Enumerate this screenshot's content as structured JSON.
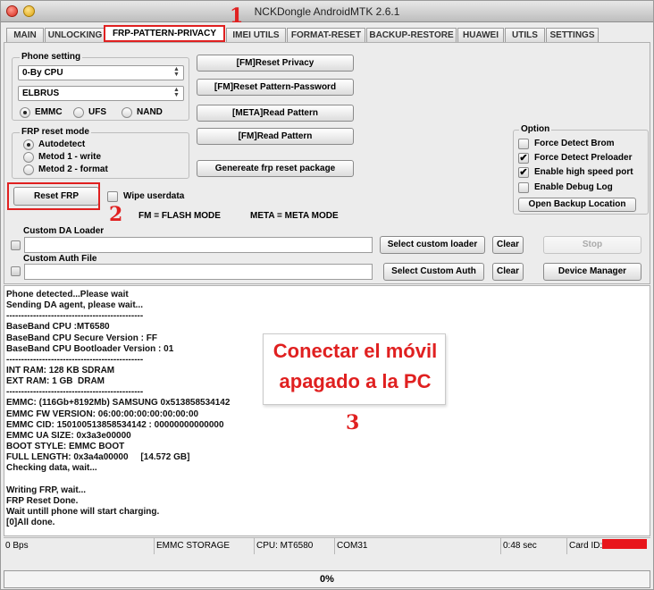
{
  "window": {
    "title": "NCKDongle AndroidMTK 2.6.1"
  },
  "tabs": [
    {
      "label": "MAIN"
    },
    {
      "label": "UNLOCKING"
    },
    {
      "label": "FRP-PATTERN-PRIVACY",
      "active": true
    },
    {
      "label": "IMEI UTILS"
    },
    {
      "label": "FORMAT-RESET"
    },
    {
      "label": "BACKUP-RESTORE"
    },
    {
      "label": "HUAWEI"
    },
    {
      "label": "UTILS"
    },
    {
      "label": "SETTINGS"
    }
  ],
  "phone_setting": {
    "title": "Phone setting",
    "cpu_select": "0-By CPU",
    "model_select": "ELBRUS",
    "storage_options": [
      {
        "label": "EMMC",
        "selected": true
      },
      {
        "label": "UFS",
        "selected": false
      },
      {
        "label": "NAND",
        "selected": false
      }
    ]
  },
  "frp_reset_mode": {
    "title": "FRP reset mode",
    "options": [
      {
        "label": "Autodetect",
        "selected": true
      },
      {
        "label": "Metod 1 - write",
        "selected": false
      },
      {
        "label": "Metod 2 - format",
        "selected": false
      }
    ]
  },
  "actions": {
    "reset_privacy": "[FM]Reset Privacy",
    "reset_pattern_password": "[FM]Reset Pattern-Password",
    "read_pattern_meta": "[META]Read Pattern",
    "read_pattern_fm": "[FM]Read Pattern",
    "generate_package": "Genereate frp reset package",
    "reset_frp": "Reset FRP"
  },
  "wipe_userdata": {
    "label": "Wipe userdata",
    "checked": false
  },
  "mode_legend": {
    "flash": "FM = FLASH MODE",
    "meta": "META = META MODE"
  },
  "options": {
    "title": "Option",
    "items": [
      {
        "label": "Force Detect Brom",
        "checked": false
      },
      {
        "label": "Force Detect Preloader",
        "checked": true
      },
      {
        "label": "Enable high speed port",
        "checked": true
      },
      {
        "label": "Enable Debug Log",
        "checked": false
      }
    ],
    "backup_location_button": "Open Backup Location"
  },
  "loaders": {
    "custom_da_label": "Custom DA Loader",
    "custom_auth_label": "Custom Auth File",
    "select_custom_loader": "Select custom loader",
    "select_custom_auth": "Select Custom Auth",
    "clear": "Clear",
    "stop": "Stop",
    "device_manager": "Device Manager"
  },
  "log_lines": [
    "Phone detected...Please wait",
    "Sending DA agent, please wait...",
    "----------------------------------------------",
    "BaseBand CPU :MT6580",
    "BaseBand CPU Secure Version : FF",
    "BaseBand CPU Bootloader Version : 01",
    "----------------------------------------------",
    "INT RAM: 128 KB SDRAM",
    "EXT RAM: 1 GB  DRAM",
    "----------------------------------------------",
    "EMMC: (116Gb+8192Mb) SAMSUNG 0x513858534142",
    "EMMC FW VERSION: 06:00:00:00:00:00:00:00",
    "EMMC CID: 150100513858534142 : 00000000000000",
    "EMMC UA SIZE: 0x3a3e00000",
    "BOOT STYLE: EMMC BOOT",
    "FULL LENGTH: 0x3a4a00000     [14.572 GB]",
    "Checking data, wait...",
    "",
    "Writing FRP, wait...",
    "FRP Reset Done.",
    "Wait untill phone will start charging.",
    "[0]All done."
  ],
  "callout": {
    "line1": "Conectar el móvil",
    "line2": "apagado a la PC"
  },
  "step_markers": {
    "one": "1",
    "two": "2",
    "three": "3"
  },
  "status": {
    "speed": "0 Bps",
    "storage": "EMMC STORAGE",
    "cpu": "CPU: MT6580",
    "port": "COM31",
    "time": "0:48 sec",
    "card_id_label": "Card ID:"
  },
  "progress": {
    "value": 0,
    "label": "0%"
  },
  "colors": {
    "annotation_red": "#e02020",
    "card_id_redaction": "#e8151b"
  }
}
